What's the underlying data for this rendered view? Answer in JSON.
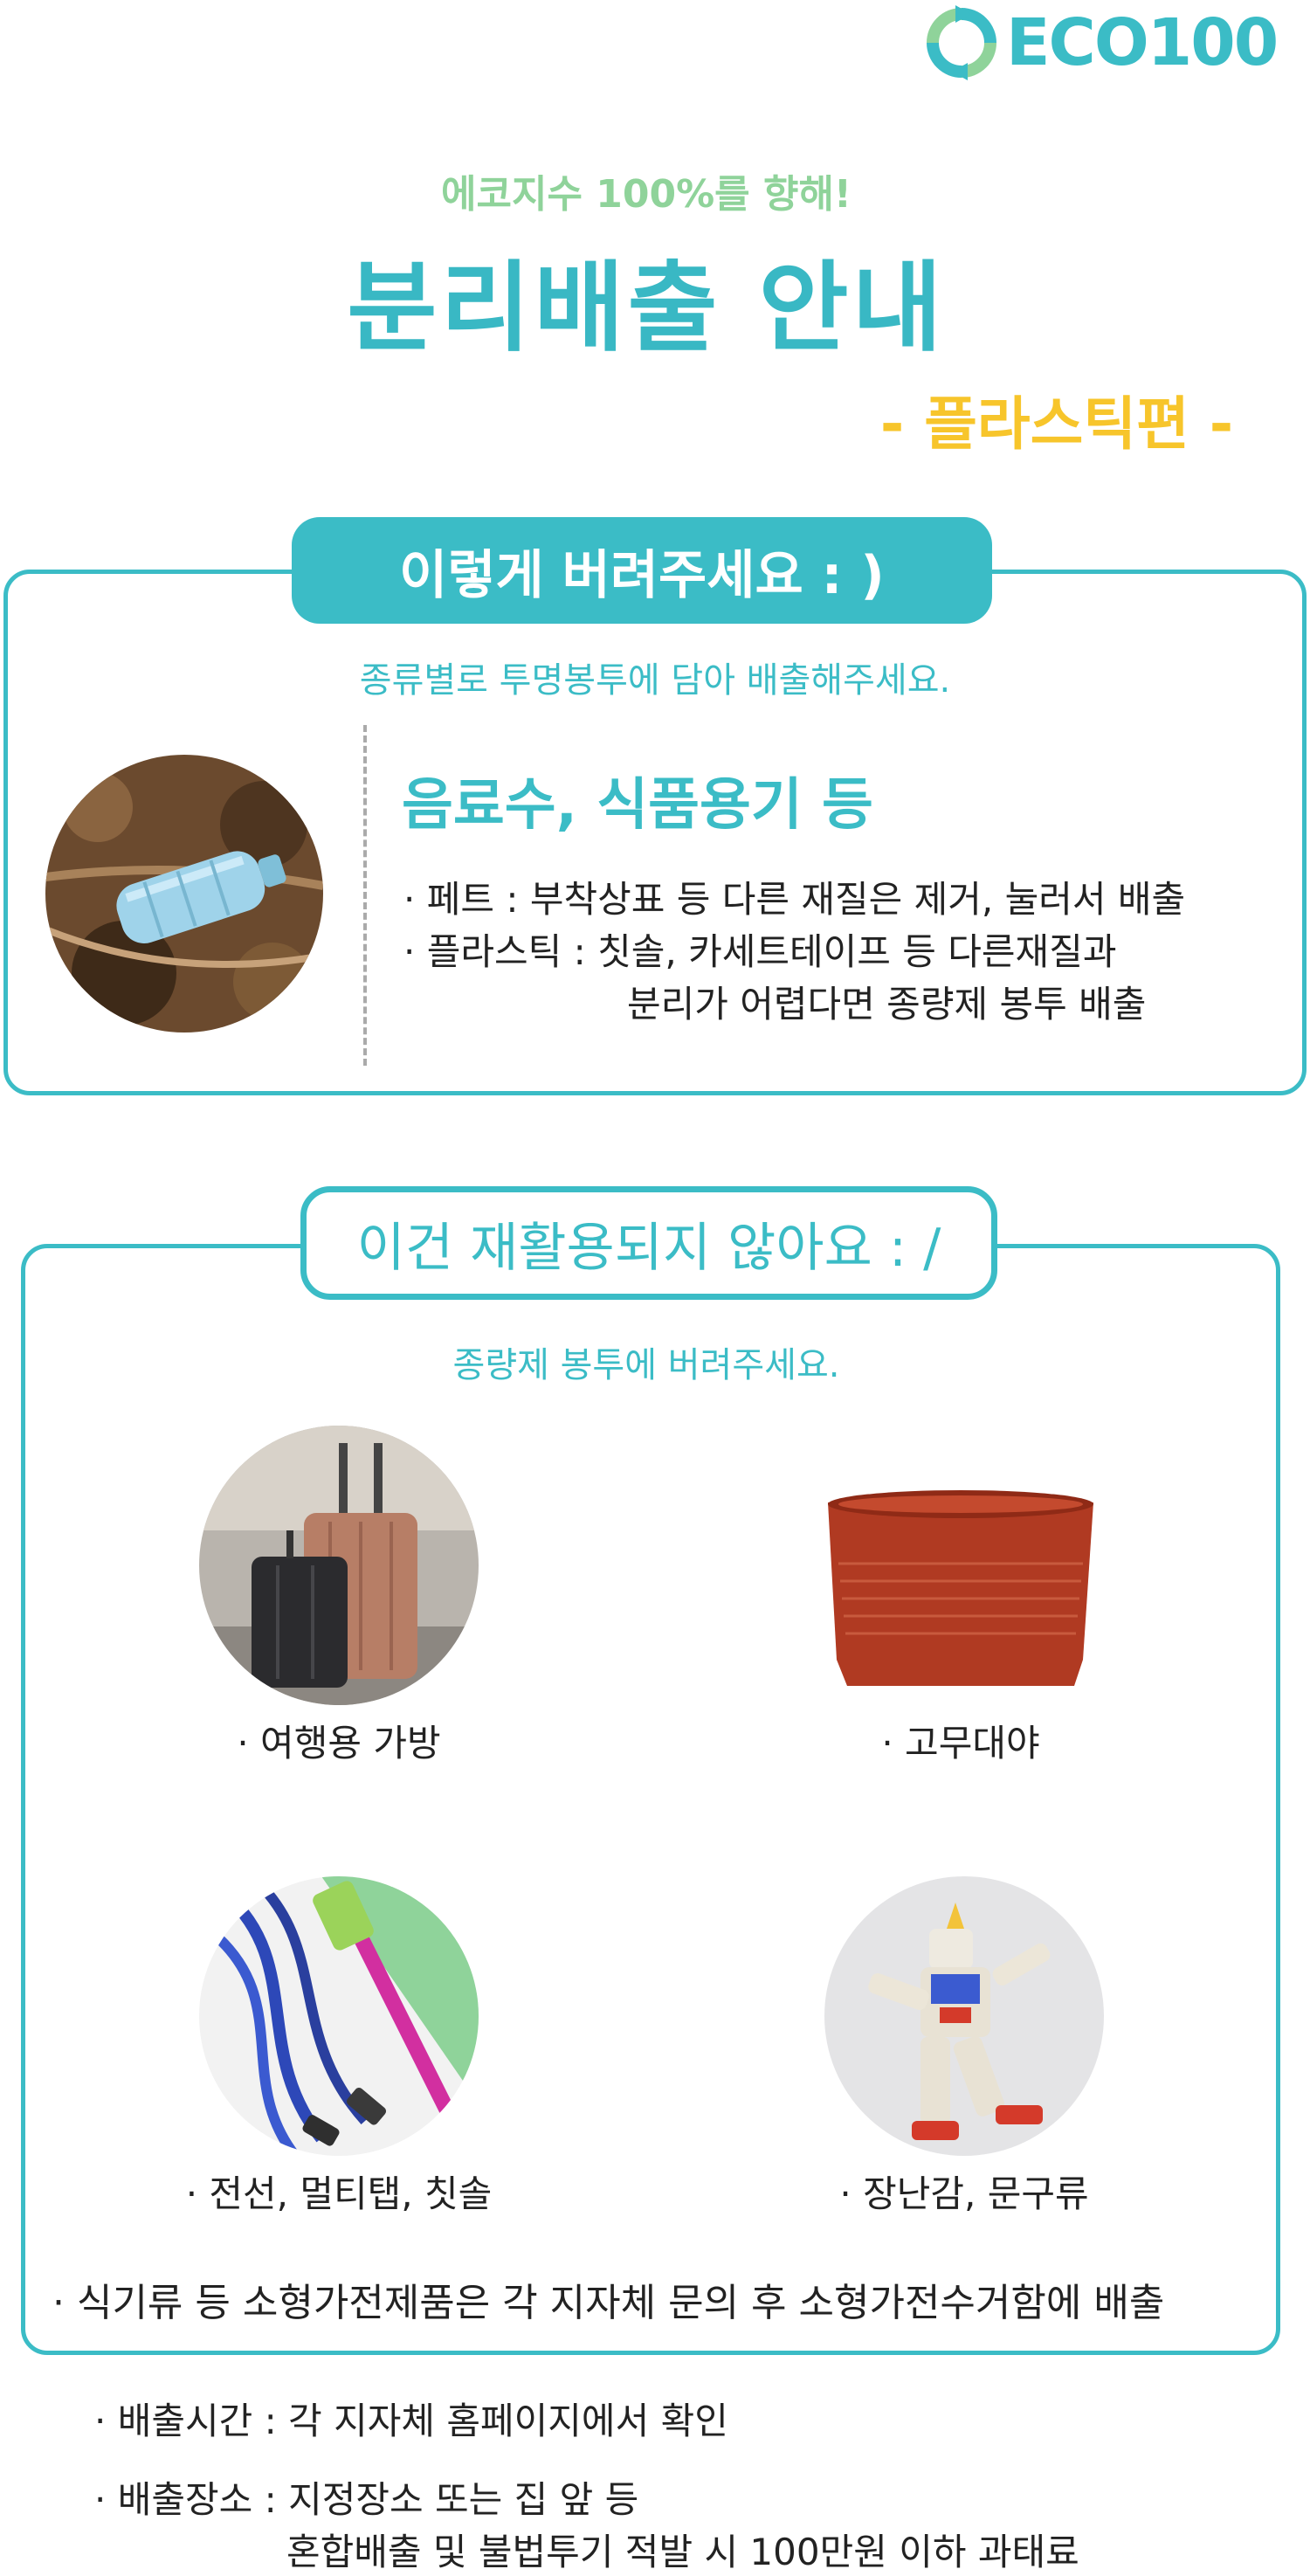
{
  "logo": {
    "text": "ECO100",
    "icon": "recycle-arrows-icon"
  },
  "header": {
    "subtitle": "에코지수 100%를 향해!",
    "title": "분리배출 안내",
    "edition": "- 플라스틱편 -"
  },
  "do_section": {
    "heading": "이렇게 버려주세요 : )",
    "instruction": "종류별로 투명봉투에 담아 배출해주세요.",
    "category_title": "음료수, 식품용기 등",
    "bullets": [
      "· 페트 : 부착상표 등 다른 재질은 제거, 눌러서 배출",
      "· 플라스틱 : 칫솔, 카세트테이프 등 다른재질과",
      "분리가 어렵다면 종량제 봉투 배출"
    ],
    "image": "plastic-bottle-photo"
  },
  "dont_section": {
    "heading": "이건 재활용되지 않아요 : /",
    "instruction": "종량제 봉투에 버려주세요.",
    "items": [
      {
        "label": "· 여행용 가방",
        "image": "suitcase-photo"
      },
      {
        "label": "· 고무대야",
        "image": "rubber-basin-photo"
      },
      {
        "label": "· 전선, 멀티탭, 칫솔",
        "image": "cables-toothbrush-photo"
      },
      {
        "label": "· 장난감, 문구류",
        "image": "toy-robot-photo"
      }
    ],
    "note": "· 식기류 등 소형가전제품은 각 지자체 문의 후 소형가전수거함에 배출"
  },
  "footer": {
    "time": "· 배출시간 : 각 지자체 홈페이지에서 확인",
    "place": "· 배출장소 : 지정장소 또는 집 앞 등",
    "penalty": "혼합배출 및 불법투기 적발 시 100만원 이하 과태료"
  },
  "colors": {
    "teal": "#3bbcc6",
    "green": "#8fd39a",
    "yellow": "#f7c52b"
  }
}
